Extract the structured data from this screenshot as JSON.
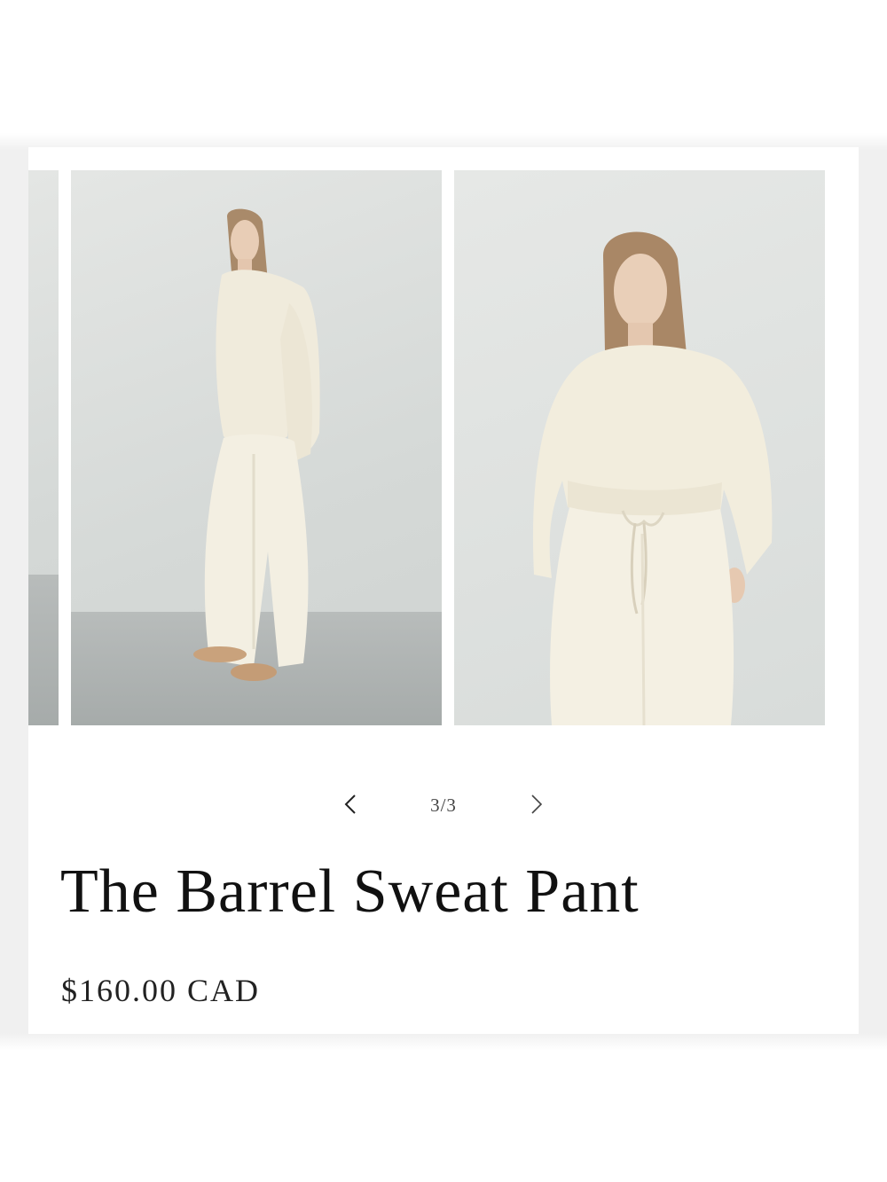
{
  "product": {
    "title": "The Barrel Sweat Pant",
    "price": "$160.00 CAD"
  },
  "gallery": {
    "counter": "3/3",
    "prev_icon": "chevron-left-icon",
    "next_icon": "chevron-right-icon",
    "slides": [
      {
        "name": "previous-product-photo"
      },
      {
        "name": "full-length-product-photo"
      },
      {
        "name": "close-up-product-photo"
      }
    ]
  },
  "colors": {
    "background": "#ffffff",
    "text": "#111111",
    "garment": "#f2eedf",
    "wall": "#d9dcd9",
    "floor": "#a9adac"
  }
}
